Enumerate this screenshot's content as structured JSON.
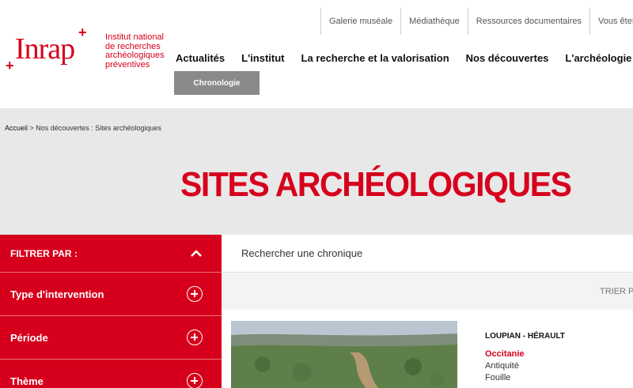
{
  "logo": {
    "name": "Inrap",
    "tagline_lines": [
      "Institut national",
      "de recherches",
      "archéologiques",
      "préventives"
    ]
  },
  "top_links": [
    "Galerie muséale",
    "Médiathèque",
    "Ressources documentaires",
    "Vous êtes"
  ],
  "main_nav": [
    "Actualités",
    "L'institut",
    "La recherche et la valorisation",
    "Nos découvertes",
    "L'archéologie"
  ],
  "sub_nav_button": "Chronologie",
  "breadcrumb": {
    "home": "Accueil",
    "rest": " > Nos découvertes : Sites archéologiques"
  },
  "page_title": "SITES ARCHÉOLOGIQUES",
  "sidebar": {
    "header": "FILTRER PAR :",
    "filters": [
      "Type d'intervention",
      "Période",
      "Thème"
    ]
  },
  "search": {
    "placeholder": "Rechercher une chronique"
  },
  "sort_label": "TRIER PA",
  "result": {
    "location": "LOUPIAN - HÉRAULT",
    "region": "Occitanie",
    "period": "Antiquité",
    "type": "Fouille"
  },
  "colors": {
    "brand_red": "#d6001c",
    "band_grey": "#e8e8e8",
    "chrono_grey": "#8a8a8a"
  }
}
